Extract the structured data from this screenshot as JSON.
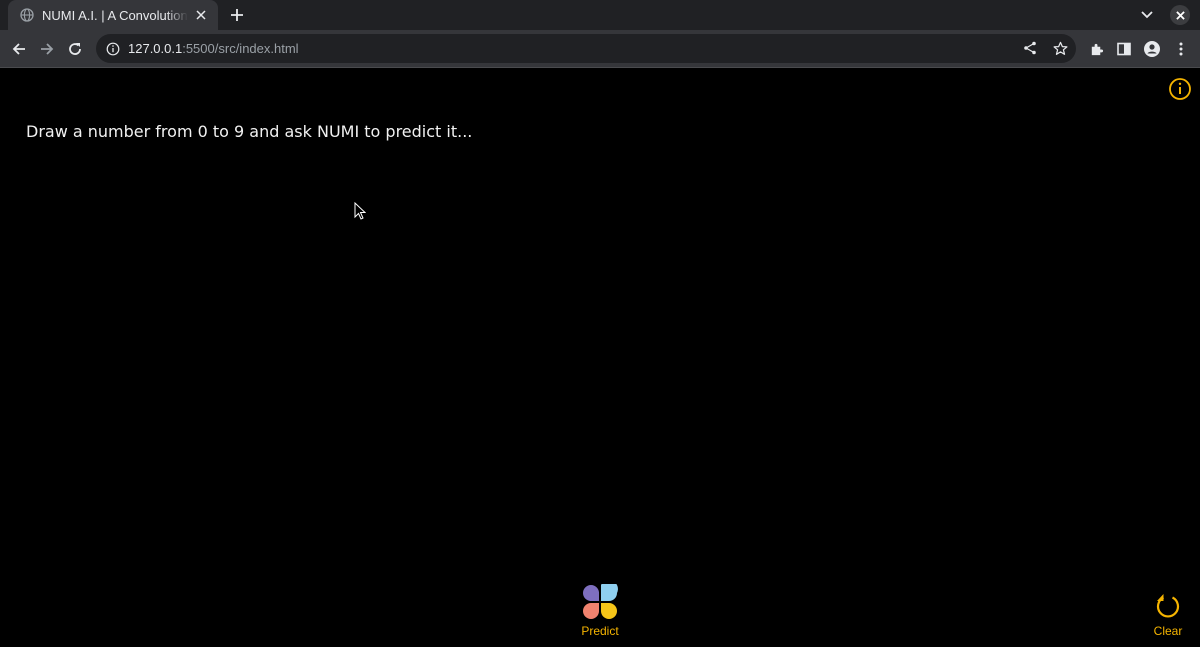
{
  "browser": {
    "tab": {
      "title": "NUMI A.I. | A Convolutional Neural Network",
      "favicon": "globe-icon",
      "close_icon": "close-icon"
    },
    "new_tab_icon": "plus-icon",
    "tab_search_icon": "chevron-down-icon",
    "window_close_icon": "close-icon",
    "toolbar": {
      "back_icon": "arrow-left-icon",
      "forward_icon": "arrow-right-icon",
      "reload_icon": "reload-icon",
      "site_info_icon": "info-icon",
      "url_host": "127.0.0.1",
      "url_rest": ":5500/src/index.html",
      "share_icon": "share-icon",
      "bookmark_icon": "star-icon",
      "extensions_icon": "puzzle-icon",
      "side_panel_icon": "side-panel-icon",
      "profile_icon": "person-icon",
      "menu_icon": "kebab-icon"
    }
  },
  "page": {
    "info_icon": "info-icon",
    "prompt": "Draw a number from 0 to 9 and ask NUMI to predict it...",
    "predict": {
      "label": "Predict",
      "icon": "petal-icon"
    },
    "clear": {
      "label": "Clear",
      "icon": "refresh-icon"
    },
    "colors": {
      "accent": "#f5b400",
      "background": "#000000",
      "petal_purple": "#7e6fbf",
      "petal_blue": "#8fd0f0",
      "petal_coral": "#f0826e",
      "petal_yellow": "#f5c518"
    }
  }
}
